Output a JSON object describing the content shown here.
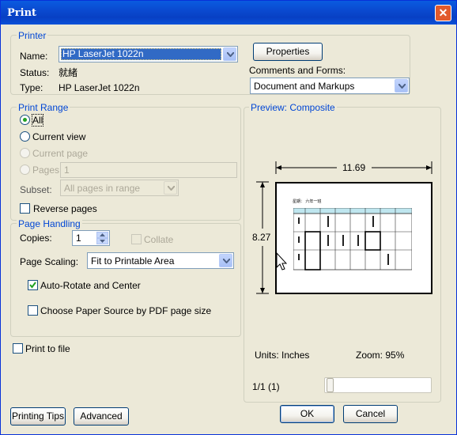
{
  "window": {
    "title": "Print",
    "close_symbol": "✕"
  },
  "printer": {
    "group_label": "Printer",
    "name_label": "Name:",
    "name_value": "HP LaserJet 1022n",
    "status_label": "Status:",
    "status_value": "就緒",
    "type_label": "Type:",
    "type_value": "HP LaserJet 1022n",
    "properties_button": "Properties",
    "comments_label": "Comments and Forms:",
    "comments_value": "Document and Markups"
  },
  "print_range": {
    "group_label": "Print Range",
    "all": "All",
    "current_view": "Current view",
    "current_page": "Current page",
    "pages": "Pages",
    "pages_value": "1",
    "subset_label": "Subset:",
    "subset_value": "All pages in range",
    "reverse_pages": "Reverse pages"
  },
  "page_handling": {
    "group_label": "Page Handling",
    "copies_label": "Copies:",
    "copies_value": "1",
    "collate": "Collate",
    "scaling_label": "Page Scaling:",
    "scaling_value": "Fit to Printable Area",
    "auto_rotate": "Auto-Rotate and Center",
    "auto_rotate_checked": true,
    "choose_paper": "Choose Paper Source by PDF page size"
  },
  "print_to_file": "Print to file",
  "preview": {
    "group_label": "Preview: Composite",
    "width_label": "11.69",
    "height_label": "8.27",
    "doc_header": "星期：  六年一班",
    "units_label": "Units: Inches",
    "zoom_label": "Zoom:  95%",
    "page_indicator": "1/1 (1)"
  },
  "buttons": {
    "printing_tips": "Printing Tips",
    "advanced": "Advanced",
    "ok": "OK",
    "cancel": "Cancel"
  },
  "colors": {
    "title_bar": "#0a4ad0",
    "group_label": "#0046d5",
    "selection": "#316ac5",
    "check_green": "#21a121",
    "table_header": "#bfe6ef"
  }
}
